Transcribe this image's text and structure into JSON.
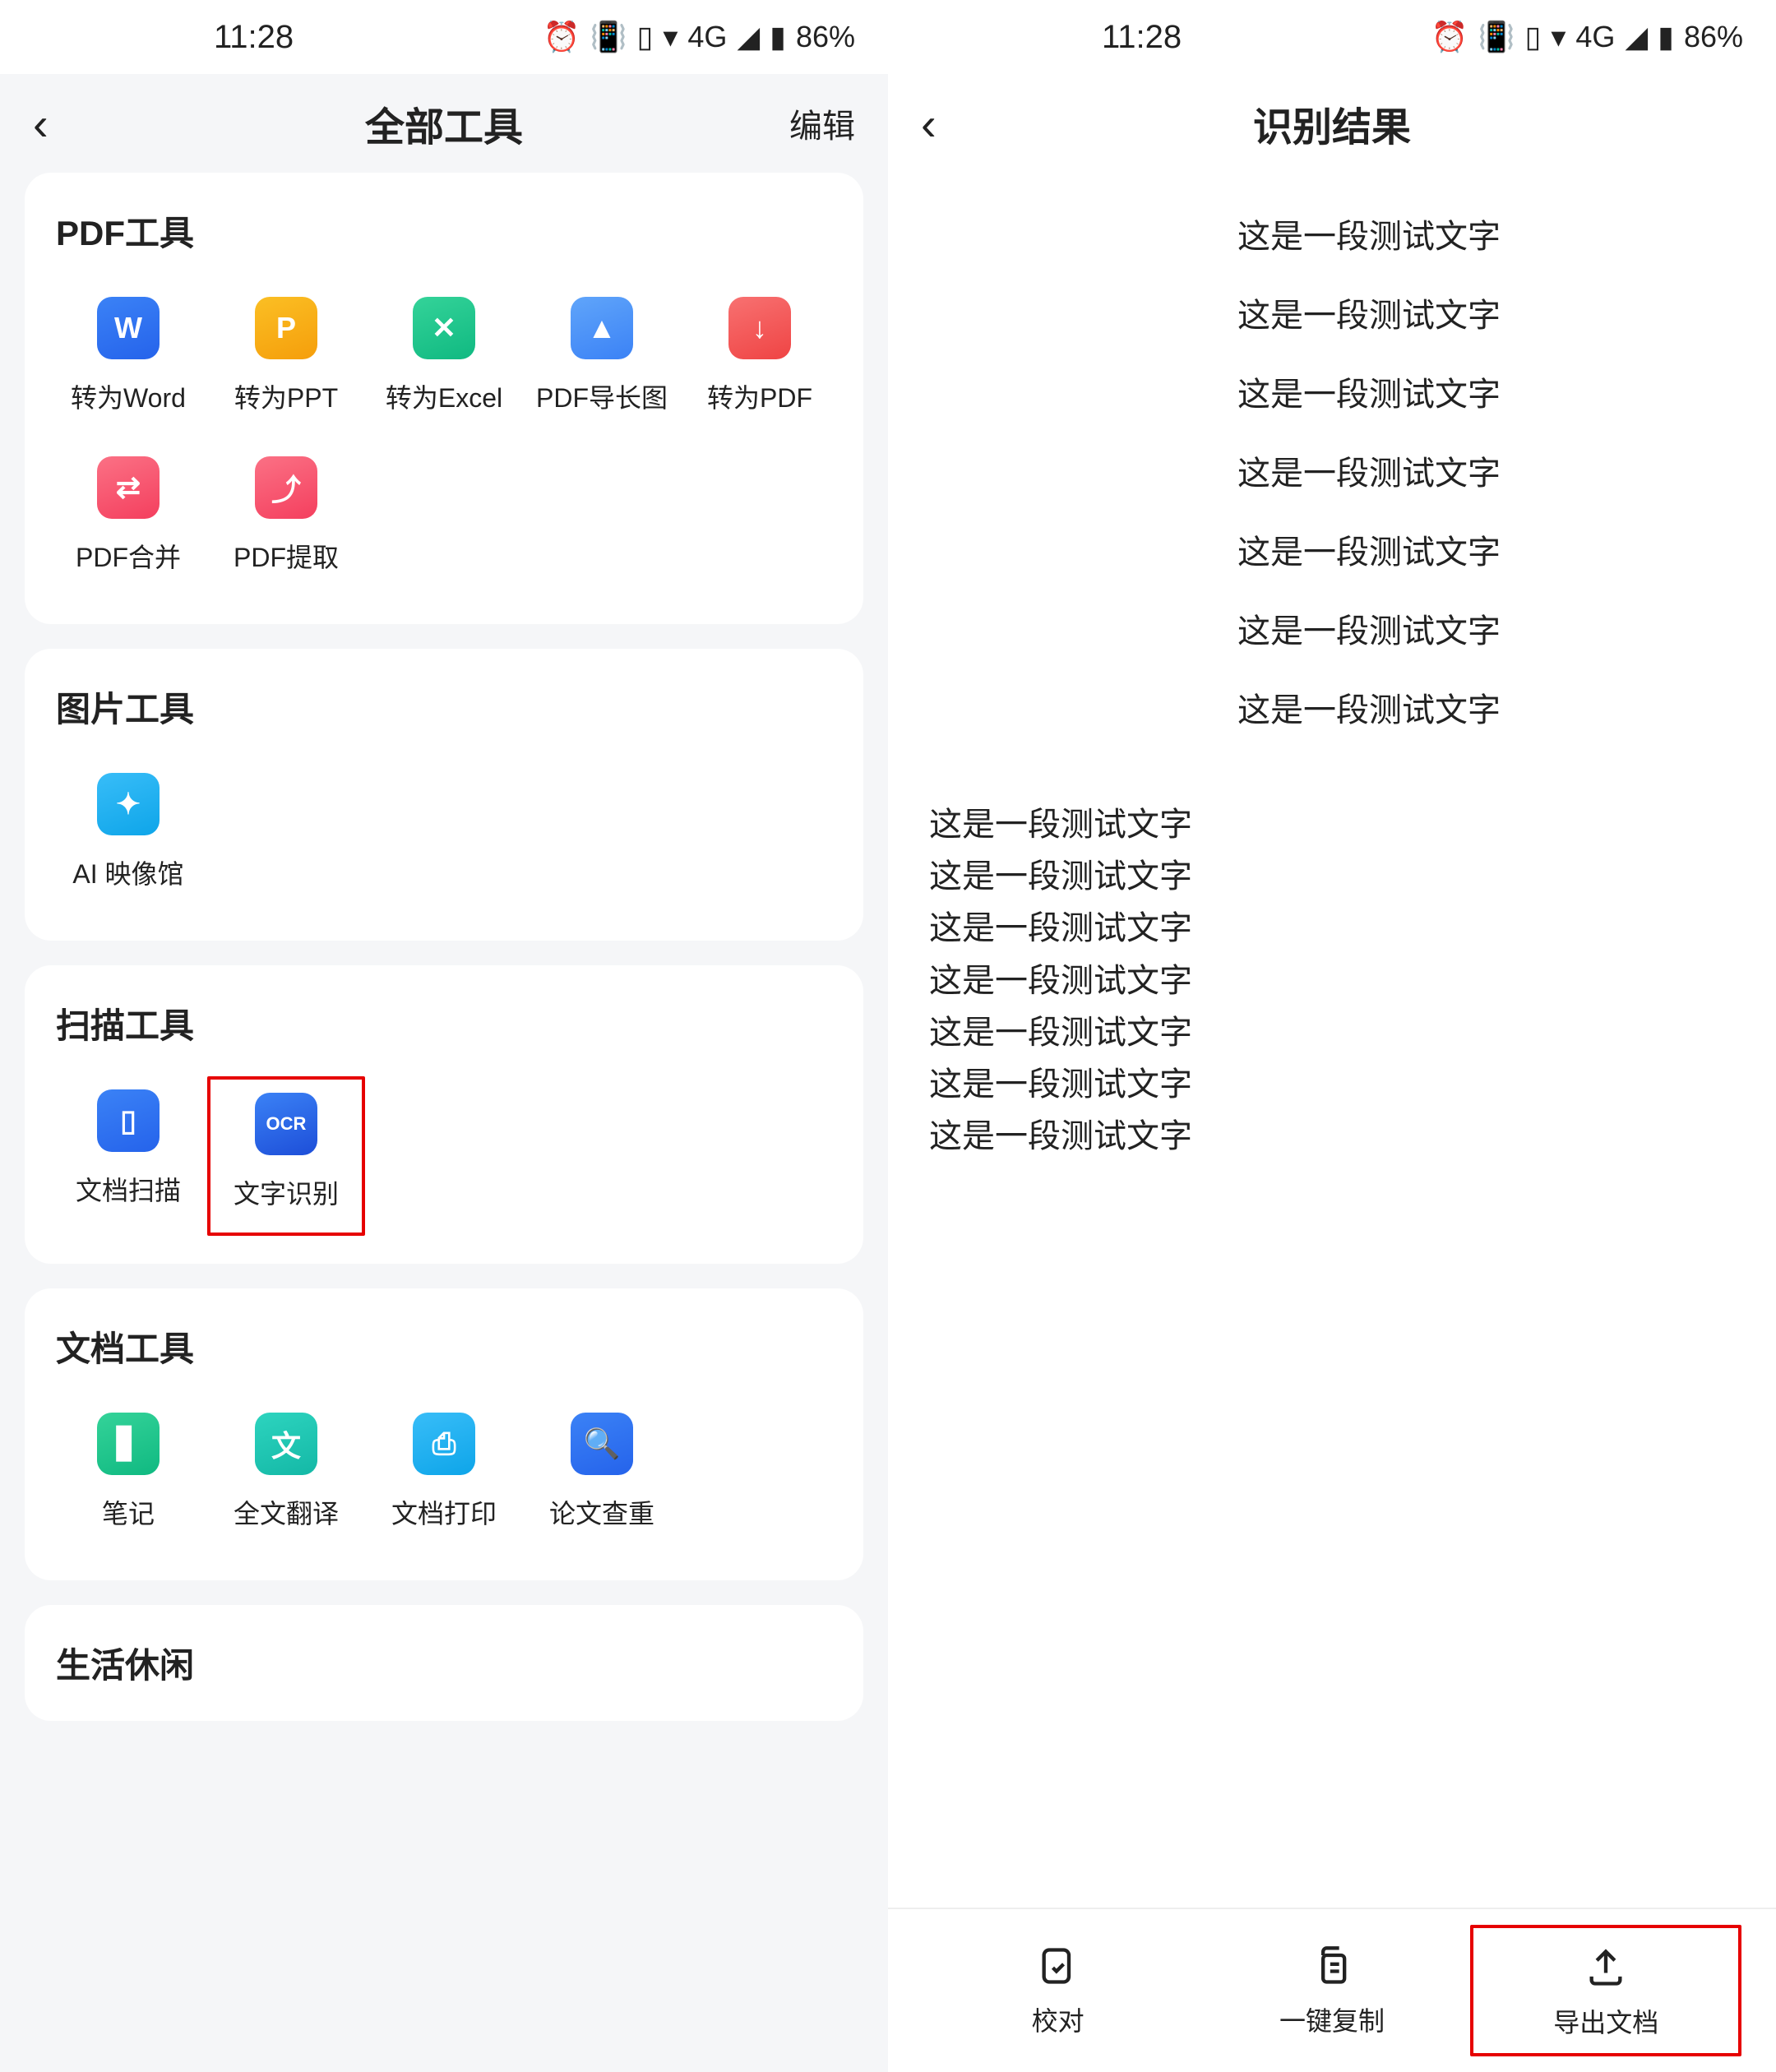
{
  "status": {
    "time": "11:28",
    "battery": "86%",
    "network": "4G"
  },
  "left": {
    "title": "全部工具",
    "edit": "编辑",
    "sections": {
      "pdf": {
        "title": "PDF工具",
        "tools": [
          {
            "label": "转为Word",
            "glyph": "W"
          },
          {
            "label": "转为PPT",
            "glyph": "P"
          },
          {
            "label": "转为Excel",
            "glyph": "✕"
          },
          {
            "label": "PDF导长图",
            "glyph": "▲"
          },
          {
            "label": "转为PDF",
            "glyph": "↓"
          },
          {
            "label": "PDF合并",
            "glyph": "⇄"
          },
          {
            "label": "PDF提取",
            "glyph": "⤴"
          }
        ]
      },
      "image": {
        "title": "图片工具",
        "tools": [
          {
            "label": "AI 映像馆",
            "glyph": "✦"
          }
        ]
      },
      "scan": {
        "title": "扫描工具",
        "tools": [
          {
            "label": "文档扫描",
            "glyph": "▯"
          },
          {
            "label": "文字识别",
            "glyph": "OCR"
          }
        ]
      },
      "doc": {
        "title": "文档工具",
        "tools": [
          {
            "label": "笔记",
            "glyph": "▋"
          },
          {
            "label": "全文翻译",
            "glyph": "文"
          },
          {
            "label": "文档打印",
            "glyph": "⎙"
          },
          {
            "label": "论文查重",
            "glyph": "🔍"
          }
        ]
      },
      "life": {
        "title": "生活休闲"
      }
    }
  },
  "right": {
    "title": "识别结果",
    "lines_centered": [
      "这是一段测试文字",
      "这是一段测试文字",
      "这是一段测试文字",
      "这是一段测试文字",
      "这是一段测试文字",
      "这是一段测试文字",
      "这是一段测试文字"
    ],
    "lines_left": [
      "这是一段测试文字",
      "这是一段测试文字",
      "这是一段测试文字",
      "这是一段测试文字",
      "这是一段测试文字",
      "这是一段测试文字",
      "这是一段测试文字"
    ],
    "bottom": [
      {
        "label": "校对"
      },
      {
        "label": "一键复制"
      },
      {
        "label": "导出文档"
      }
    ]
  }
}
